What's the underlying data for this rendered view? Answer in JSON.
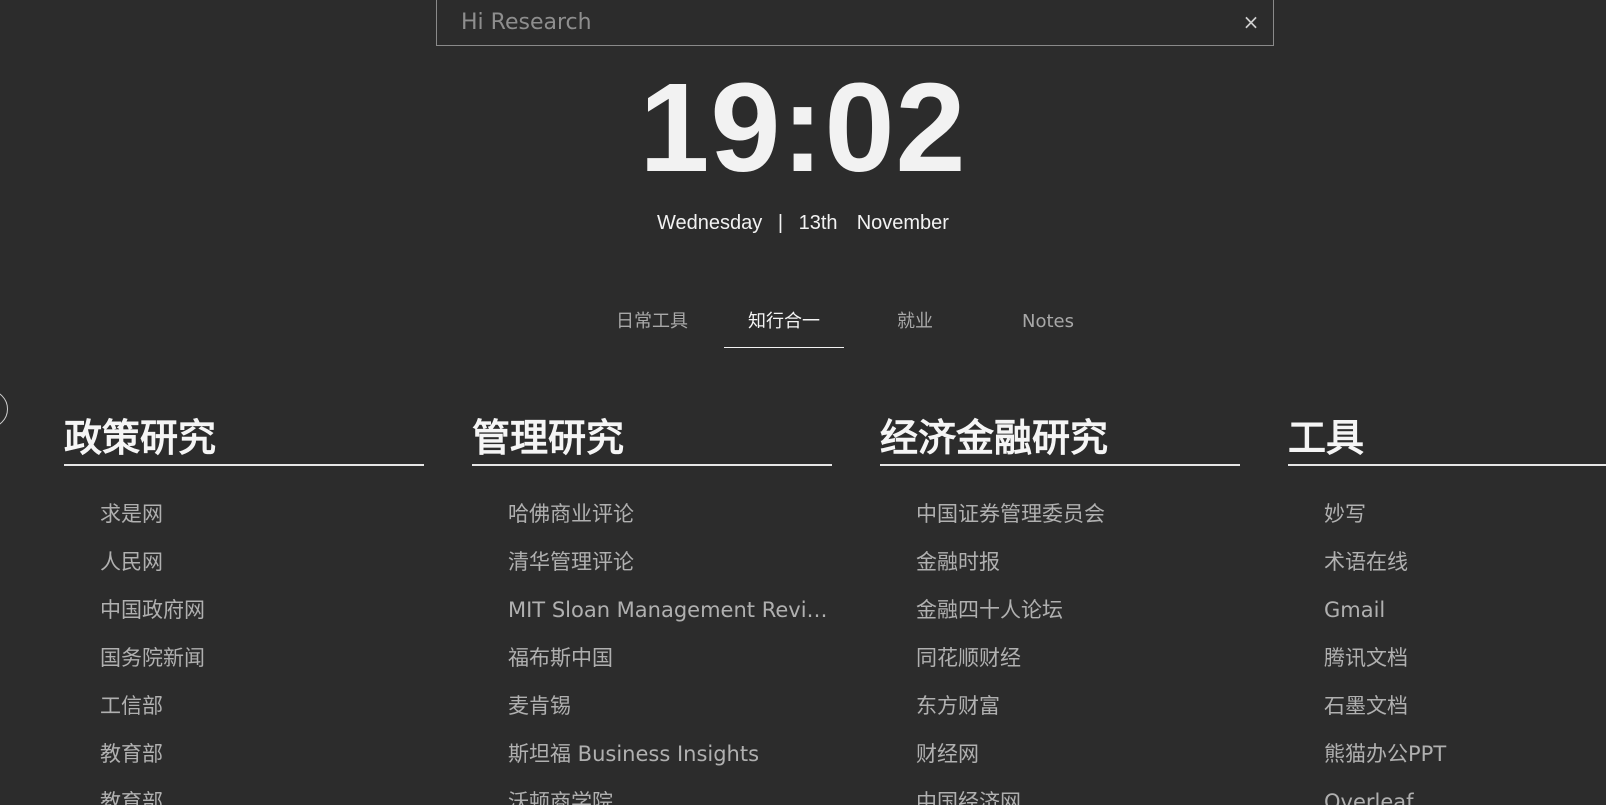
{
  "search": {
    "placeholder": "Hi Research",
    "clear_label": "×"
  },
  "clock": {
    "time": "19:02"
  },
  "date": {
    "weekday": "Wednesday",
    "separator": "|",
    "day": "13th",
    "month": "November"
  },
  "tabs": [
    {
      "label": "日常工具",
      "active": false
    },
    {
      "label": "知行合一",
      "active": true
    },
    {
      "label": "就业",
      "active": false
    },
    {
      "label": "Notes",
      "active": false
    }
  ],
  "columns": [
    {
      "title": "政策研究",
      "items": [
        "求是网",
        "人民网",
        "中国政府网",
        "国务院新闻",
        "工信部",
        "教育部",
        "教育部"
      ]
    },
    {
      "title": "管理研究",
      "items": [
        "哈佛商业评论",
        "清华管理评论",
        "MIT Sloan Management Review",
        "福布斯中国",
        "麦肯锡",
        "斯坦福 Business Insights",
        "沃顿商学院"
      ]
    },
    {
      "title": "经济金融研究",
      "items": [
        "中国证券管理委员会",
        "金融时报",
        "金融四十人论坛",
        "同花顺财经",
        "东方财富",
        "财经网",
        "中国经济网"
      ]
    },
    {
      "title": "工具",
      "items": [
        "妙写",
        "术语在线",
        "Gmail",
        "腾讯文档",
        "石墨文档",
        "熊猫办公PPT",
        "Overleaf"
      ]
    }
  ]
}
